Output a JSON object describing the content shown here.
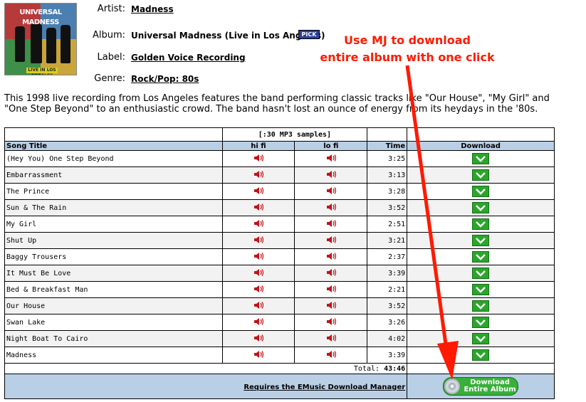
{
  "album_cover": {
    "band_text": "UNIVERSAL MADNESS",
    "subtitle_text": "LIVE IN LOS ANGELES"
  },
  "details": {
    "artist_label": "Artist:",
    "artist_value": "Madness",
    "album_label": "Album:",
    "album_value": "Universal Madness (Live in Los Angeles)",
    "pick_badge": "PICK",
    "label_label": "Label:",
    "label_value": "Golden Voice Recording",
    "genre_label": "Genre:",
    "genre_value": "Rock/Pop: 80s"
  },
  "callout": {
    "line1": "Use MJ to download",
    "line2": "entire album with one click",
    "color": "#ff1a00"
  },
  "description": "This 1998 live recording from Los Angeles features the band performing classic tracks like \"Our House\", \"My Girl\" and \"One Step Beyond\" to an enthusiastic crowd. The band hasn't lost an ounce of energy from its heydays in the '80s.",
  "table": {
    "samples_header": "[:30 MP3 samples]",
    "columns": {
      "song_title": "Song Title",
      "hi_fi": "hi fi",
      "lo_fi": "lo fi",
      "time": "Time",
      "download": "Download"
    },
    "tracks": [
      {
        "title": "(Hey You) One Step Beyond",
        "time": "3:25"
      },
      {
        "title": "Embarrassment",
        "time": "3:13"
      },
      {
        "title": "The Prince",
        "time": "3:28"
      },
      {
        "title": "Sun & The Rain",
        "time": "3:52"
      },
      {
        "title": "My Girl",
        "time": "2:51"
      },
      {
        "title": "Shut Up",
        "time": "3:21"
      },
      {
        "title": "Baggy Trousers",
        "time": "2:37"
      },
      {
        "title": "It Must Be Love",
        "time": "3:39"
      },
      {
        "title": "Bed & Breakfast Man",
        "time": "2:21"
      },
      {
        "title": "Our House",
        "time": "3:52"
      },
      {
        "title": "Swan Lake",
        "time": "3:26"
      },
      {
        "title": "Night Boat To Cairo",
        "time": "4:02"
      },
      {
        "title": "Madness",
        "time": "3:39"
      }
    ],
    "total_label": "Total:",
    "total_value": "43:46",
    "requires_link": "Requires the EMusic Download Manager",
    "album_button_line1": "Download",
    "album_button_line2": "Entire Album"
  },
  "icons": {
    "speaker": "speaker-icon",
    "download": "download-arrow-icon",
    "cd": "cd-icon"
  },
  "colors": {
    "header_blue": "#b9cfe6",
    "download_green": "#2aa62a",
    "speaker_red": "#c0141a"
  }
}
